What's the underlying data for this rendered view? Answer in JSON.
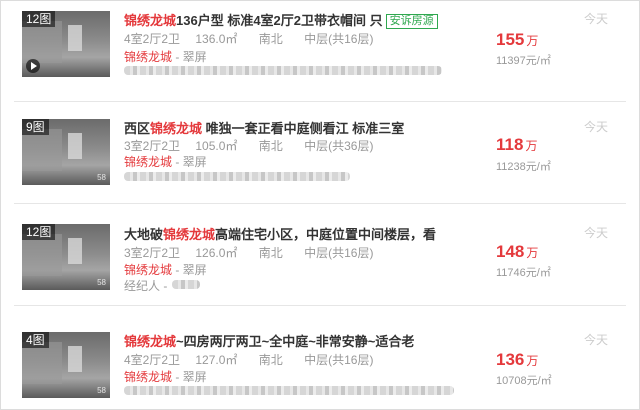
{
  "listings": [
    {
      "photo_count": "12图",
      "has_video": true,
      "title_highlight": "锦绣龙城",
      "title_rest": "136户型 标准4室2厅2卫带衣帽间 只",
      "badge": "安诉房源",
      "layout": "4室2厅2卫",
      "size": "136.0㎡",
      "direction": "南北",
      "floor": "中层(共16层)",
      "community": "锦绣龙城",
      "district": " - 翠屏",
      "price": "155",
      "price_unit": "万",
      "unit_price": "11397元/㎡",
      "date": "今天"
    },
    {
      "photo_count": "9图",
      "has_video": false,
      "title_pre": "西区",
      "title_highlight": "锦绣龙城",
      "title_rest": " 唯独一套正看中庭侧看江 标准三室",
      "layout": "3室2厅2卫",
      "size": "105.0㎡",
      "direction": "南北",
      "floor": "中层(共36层)",
      "community": "锦绣龙城",
      "district": " - 翠屏",
      "price": "118",
      "price_unit": "万",
      "unit_price": "11238元/㎡",
      "date": "今天"
    },
    {
      "photo_count": "12图",
      "has_video": false,
      "title_pre": "大地破",
      "title_highlight": "锦绣龙城",
      "title_rest": "高端住宅小区，中庭位置中间楼层，看",
      "layout": "3室2厅2卫",
      "size": "126.0㎡",
      "direction": "南北",
      "floor": "中层(共16层)",
      "community": "锦绣龙城",
      "district": " - 翠屏",
      "agent_label": "经纪人 -",
      "price": "148",
      "price_unit": "万",
      "unit_price": "11746元/㎡",
      "date": "今天"
    },
    {
      "photo_count": "4图",
      "has_video": false,
      "title_highlight": "锦绣龙城",
      "title_rest": "~四房两厅两卫~全中庭~非常安静~适合老",
      "layout": "4室2厅2卫",
      "size": "127.0㎡",
      "direction": "南北",
      "floor": "中层(共16层)",
      "community": "锦绣龙城",
      "district": " - 翠屏",
      "price": "136",
      "price_unit": "万",
      "unit_price": "10708元/㎡",
      "date": "今天"
    }
  ],
  "colors": {
    "accent_red": "#e4393c",
    "badge_green": "#2fa84f",
    "muted_gray": "#999999"
  }
}
